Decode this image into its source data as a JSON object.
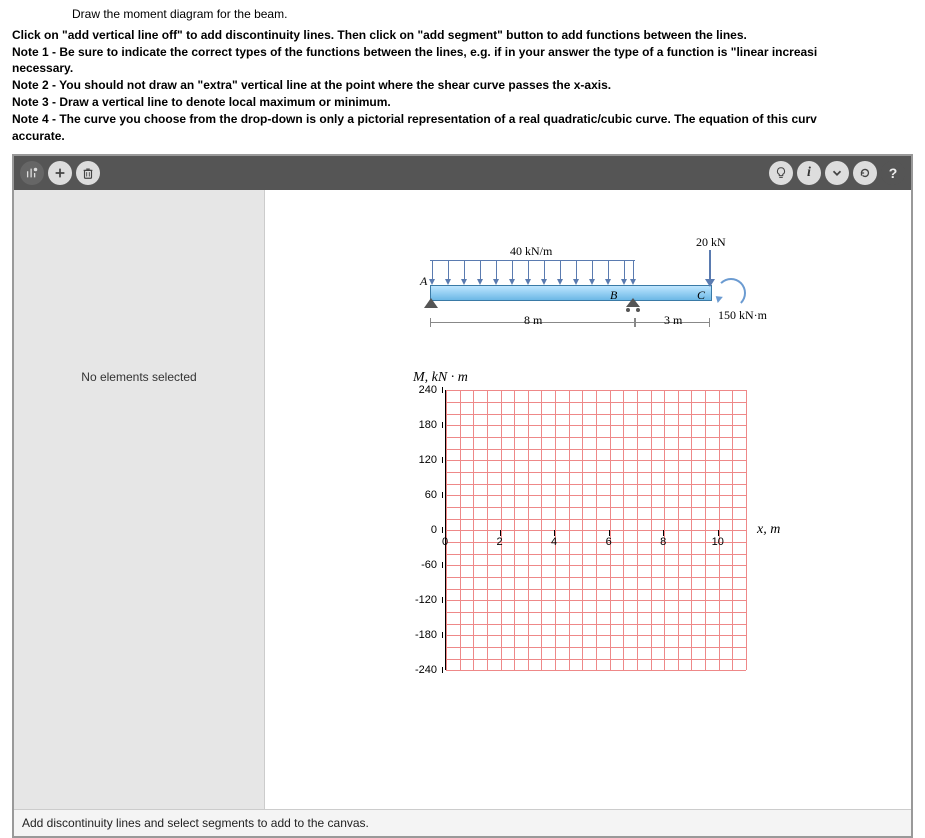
{
  "instructions": {
    "intro": "Draw the moment diagram for the beam.",
    "line1_a": "Click on \"add vertical line off\" to add discontinuity lines. Then click on \"add segment\" button to add functions between the lines.",
    "note1": "Note 1 - Be sure to indicate the correct types of the functions between the lines, e.g. if in your answer the type of a function is \"linear increasi",
    "necessary": "necessary.",
    "note2": "Note 2 - You should not draw an \"extra\" vertical line at the point where the shear curve passes the x-axis.",
    "note3": "Note 3 - Draw a vertical line to denote local maximum or minimum.",
    "note4": "Note 4 - The curve you choose from the drop-down is only a pictorial representation of a real quadratic/cubic curve. The equation of this curv",
    "accurate": "accurate."
  },
  "side_panel": {
    "status": "No elements selected"
  },
  "beam": {
    "dist_load": "40 kN/m",
    "point_load": "20 kN",
    "moment": "150 kN·m",
    "span1": "8 m",
    "span2": "3 m",
    "ptA": "A",
    "ptB": "B",
    "ptC": "C"
  },
  "chart_data": {
    "type": "line",
    "title": "M, kN · m",
    "xlabel": "x, m",
    "ylabel": "",
    "xlim": [
      0,
      11
    ],
    "ylim": [
      -240,
      240
    ],
    "xticks": [
      0,
      2,
      4,
      6,
      8,
      10
    ],
    "yticks": [
      240,
      180,
      120,
      60,
      0,
      -60,
      -120,
      -180,
      -240
    ],
    "series": []
  },
  "status": {
    "hint": "Add discontinuity lines and select segments to add to the canvas."
  }
}
